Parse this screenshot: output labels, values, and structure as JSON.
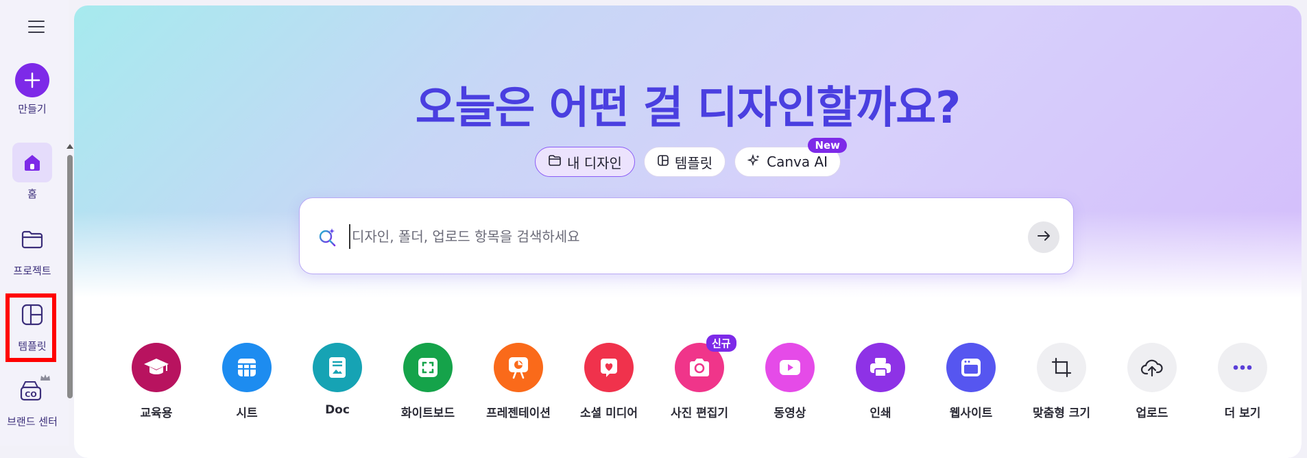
{
  "sidebar": {
    "create_label": "만들기",
    "items": [
      {
        "label": "홈"
      },
      {
        "label": "프로젝트"
      },
      {
        "label": "템플릿"
      },
      {
        "label": "브랜드 센터"
      }
    ]
  },
  "main": {
    "headline": "오늘은 어떤 걸 디자인할까요?",
    "tabs": [
      {
        "label": "내 디자인"
      },
      {
        "label": "템플릿"
      },
      {
        "label": "Canva AI",
        "badge": "New"
      }
    ],
    "search": {
      "placeholder": "디자인, 폴더, 업로드 항목을 검색하세요"
    },
    "design_types": [
      {
        "label": "교육용",
        "color": "#b8135f"
      },
      {
        "label": "시트",
        "color": "#1d8cf0"
      },
      {
        "label": "Doc",
        "color": "#16a3b4"
      },
      {
        "label": "화이트보드",
        "color": "#15a34a"
      },
      {
        "label": "프레젠테이션",
        "color": "#fa6a1a"
      },
      {
        "label": "소셜 미디어",
        "color": "#f0324c"
      },
      {
        "label": "사진 편집기",
        "color": "#f0358a",
        "badge": "신규"
      },
      {
        "label": "동영상",
        "color": "#e54be8"
      },
      {
        "label": "인쇄",
        "color": "#8e32e6"
      },
      {
        "label": "웹사이트",
        "color": "#5656f0"
      },
      {
        "label": "맞춤형 크기",
        "color": "#efeff2"
      },
      {
        "label": "업로드",
        "color": "#efeff2"
      },
      {
        "label": "더 보기",
        "color": "#efeff2"
      }
    ]
  },
  "colors": {
    "accent": "#7d2ae8",
    "headline": "#4a3fe0"
  }
}
